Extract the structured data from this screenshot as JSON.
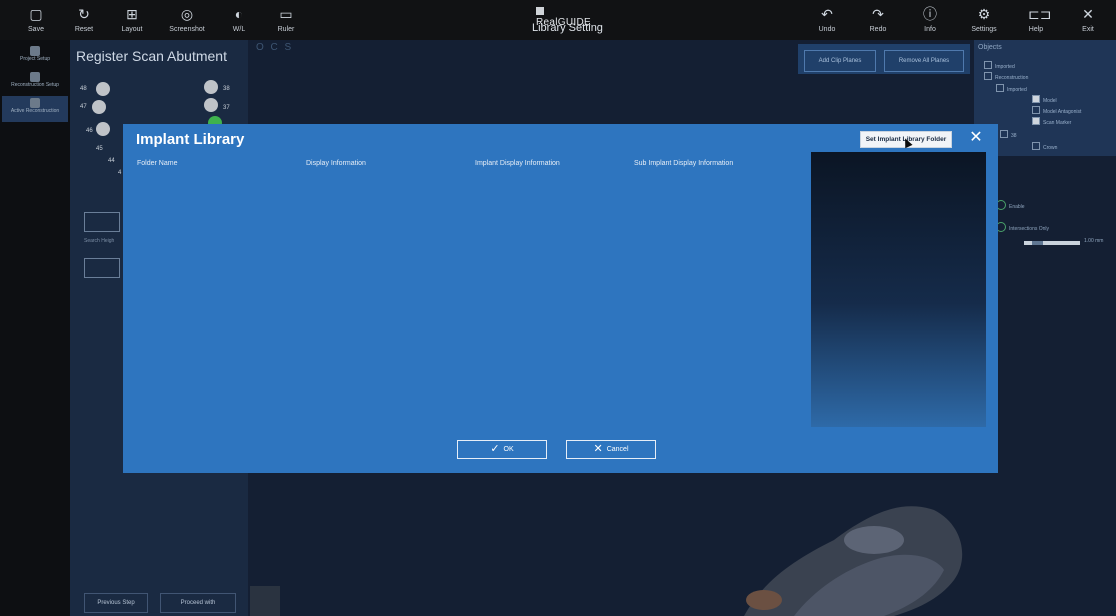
{
  "toolbar": {
    "left_buttons": [
      {
        "label": "Save",
        "icon": "save-icon",
        "glyph": "▢"
      },
      {
        "label": "Reset",
        "icon": "reset-icon",
        "glyph": "↻"
      },
      {
        "label": "Layout",
        "icon": "layout-icon",
        "glyph": "⊞"
      },
      {
        "label": "Screenshot",
        "icon": "camera-icon",
        "glyph": "◎"
      },
      {
        "label": "W/L",
        "icon": "contrast-icon",
        "glyph": "◐"
      },
      {
        "label": "Ruler",
        "icon": "ruler-icon",
        "glyph": "▭"
      }
    ],
    "app_logo": "RealGUIDE",
    "screen_title": "Library Setting",
    "right_buttons": [
      {
        "label": "Undo",
        "icon": "undo-icon",
        "glyph": "↶"
      },
      {
        "label": "Redo",
        "icon": "redo-icon",
        "glyph": "↷"
      },
      {
        "label": "Info",
        "icon": "info-icon",
        "glyph": "ⓘ"
      },
      {
        "label": "Settings",
        "icon": "gear-icon",
        "glyph": "⚙"
      },
      {
        "label": "Help",
        "icon": "help-book-icon",
        "glyph": "⊏⊐"
      },
      {
        "label": "Exit",
        "icon": "close-icon",
        "glyph": "✕"
      }
    ]
  },
  "steps": [
    {
      "label": "Project Setup",
      "active": false
    },
    {
      "label": "Reconstruction Setup",
      "active": false
    },
    {
      "label": "Active Reconstruction",
      "active": true
    }
  ],
  "left_panel": {
    "title": "Register Scan Abutment",
    "tooth_numbers": [
      "48",
      "47",
      "46",
      "45",
      "44",
      "4",
      "38",
      "37"
    ],
    "search_hint": "Search Heigh",
    "previous_button": "Previous Step",
    "proceed_button": "Proceed with"
  },
  "viewport": {
    "view_tabs": "O C S",
    "clip_buttons": [
      "Add Clip Planes",
      "Remove All Planes"
    ]
  },
  "objects_panel": {
    "title": "Objects",
    "rows": [
      "Imported",
      "Reconstruction",
      "Imported",
      "Model",
      "Model Antagonist",
      "Scan Marker",
      "38",
      "Crown"
    ]
  },
  "properties": {
    "option1": "Enable",
    "option2": "Intersections Only",
    "slider_value": "1.00 mm",
    "slider_level": 0.2
  },
  "modal": {
    "title": "Implant Library",
    "set_folder_button": "Set Implant Library Folder",
    "columns": [
      "Folder Name",
      "Display Information",
      "Implant Display Information",
      "Sub Implant Display Information"
    ],
    "ok_button": "OK",
    "cancel_button": "Cancel"
  },
  "colors": {
    "modal_blue": "#2e75bf",
    "toolbar_bg": "#111214",
    "panel_bg": "#1a2a42"
  }
}
